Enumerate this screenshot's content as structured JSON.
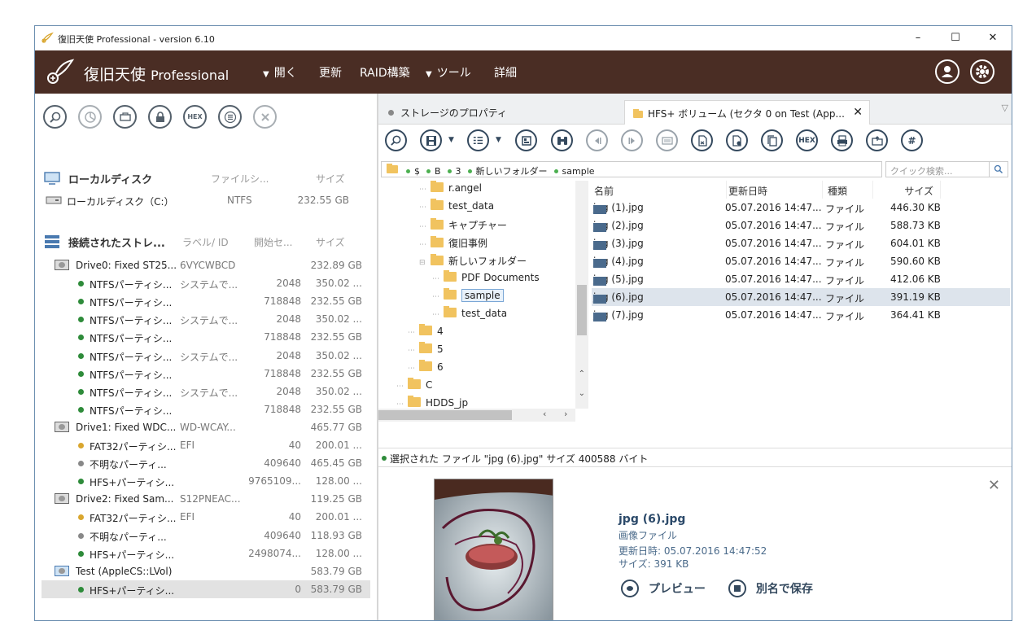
{
  "window": {
    "title": "復旧天使 Professional - version 6.10",
    "minimize": "–",
    "maximize": "☐",
    "close": "✕"
  },
  "menubar": {
    "brand": "復旧天使",
    "brand_pro": "Professional",
    "items": [
      "開く",
      "更新",
      "RAID構築",
      "ツール",
      "詳細"
    ],
    "bg_color": "#4a2d24"
  },
  "left": {
    "local_section": {
      "label": "ローカルディスク",
      "col_fs": "ファイルシ...",
      "col_size": "サイズ"
    },
    "local_drive": {
      "name": "ローカルディスク（C:）",
      "fs": "NTFS",
      "size": "232.55 GB"
    },
    "storage_section": {
      "label": "接続されたストレ...",
      "col_label": "ラベル/ ID",
      "col_start": "開始セ...",
      "col_size": "サイズ"
    },
    "rows": [
      {
        "type": "disk",
        "name": "Drive0: Fixed ST25...",
        "label": "6VYCWBCD",
        "start": "",
        "size": "232.89 GB"
      },
      {
        "type": "part",
        "color": "#2e8b3a",
        "name": "NTFSパーティシ...",
        "label": "システムで...",
        "start": "2048",
        "size": "350.02 ..."
      },
      {
        "type": "part",
        "color": "#2e8b3a",
        "name": "NTFSパーティシ...",
        "label": "",
        "start": "718848",
        "size": "232.55 GB"
      },
      {
        "type": "part",
        "color": "#2e8b3a",
        "name": "NTFSパーティシ...",
        "label": "システムで...",
        "start": "2048",
        "size": "350.02 ..."
      },
      {
        "type": "part",
        "color": "#2e8b3a",
        "name": "NTFSパーティシ...",
        "label": "",
        "start": "718848",
        "size": "232.55 GB"
      },
      {
        "type": "part",
        "color": "#2e8b3a",
        "name": "NTFSパーティシ...",
        "label": "システムで...",
        "start": "2048",
        "size": "350.02 ..."
      },
      {
        "type": "part",
        "color": "#2e8b3a",
        "name": "NTFSパーティシ...",
        "label": "",
        "start": "718848",
        "size": "232.55 GB"
      },
      {
        "type": "part",
        "color": "#2e8b3a",
        "name": "NTFSパーティシ...",
        "label": "システムで...",
        "start": "2048",
        "size": "350.02 ..."
      },
      {
        "type": "part",
        "color": "#2e8b3a",
        "name": "NTFSパーティシ...",
        "label": "",
        "start": "718848",
        "size": "232.55 GB"
      },
      {
        "type": "disk",
        "name": "Drive1: Fixed WDC...",
        "label": "WD-WCAY...",
        "start": "",
        "size": "465.77 GB"
      },
      {
        "type": "part",
        "color": "#d9a62e",
        "name": "FAT32パーティシ...",
        "label": "EFI",
        "start": "40",
        "size": "200.01 ..."
      },
      {
        "type": "part",
        "color": "#888888",
        "name": "不明なパーティ...",
        "label": "",
        "start": "409640",
        "size": "465.45 GB"
      },
      {
        "type": "part",
        "color": "#2e8b3a",
        "name": "HFS+パーティシ...",
        "label": "",
        "start": "9765109...",
        "size": "128.00 ..."
      },
      {
        "type": "disk",
        "name": "Drive2: Fixed Sam...",
        "label": "S12PNEAC...",
        "start": "",
        "size": "119.25 GB"
      },
      {
        "type": "part",
        "color": "#d9a62e",
        "name": "FAT32パーティシ...",
        "label": "EFI",
        "start": "40",
        "size": "200.01 ..."
      },
      {
        "type": "part",
        "color": "#888888",
        "name": "不明なパーティ...",
        "label": "",
        "start": "409640",
        "size": "118.93 GB"
      },
      {
        "type": "part",
        "color": "#2e8b3a",
        "name": "HFS+パーティシ...",
        "label": "",
        "start": "2498074...",
        "size": "128.00 ..."
      },
      {
        "type": "vdisk",
        "name": "Test (AppleCS::LVol)",
        "label": "",
        "start": "",
        "size": "583.79 GB"
      },
      {
        "type": "part",
        "color": "#2e8b3a",
        "name": "HFS+パーティシ...",
        "label": "",
        "start": "0",
        "size": "583.79 GB",
        "selected": true
      }
    ]
  },
  "tabs": {
    "storage_props": "ストレージのプロパティ",
    "volume": "HFS+ ボリューム (セクタ 0 on Test (App..."
  },
  "toolbar2": {
    "hex": "HEX"
  },
  "breadcrumb": [
    "$",
    "B",
    "3",
    "新しいフォルダー",
    "sample"
  ],
  "search": {
    "placeholder": "クイック検索..."
  },
  "tree": [
    {
      "label": "r.angel",
      "indent": 2
    },
    {
      "label": "test_data",
      "indent": 2
    },
    {
      "label": "キャプチャー",
      "indent": 2
    },
    {
      "label": "復旧事例",
      "indent": 2
    },
    {
      "label": "新しいフォルダー",
      "indent": 2,
      "expanded": true
    },
    {
      "label": "PDF Documents",
      "indent": 3
    },
    {
      "label": "sample",
      "indent": 3,
      "selected": true
    },
    {
      "label": "test_data",
      "indent": 3
    },
    {
      "label": "4",
      "indent": 1
    },
    {
      "label": "5",
      "indent": 1
    },
    {
      "label": "6",
      "indent": 1
    },
    {
      "label": "C",
      "indent": 0
    },
    {
      "label": "HDDS_jp",
      "indent": 0
    }
  ],
  "files": {
    "headers": {
      "name": "名前",
      "date": "更新日時",
      "kind": "種類",
      "size": "サイズ"
    },
    "rows": [
      {
        "name": "jpg (1).jpg",
        "date": "05.07.2016 14:47...",
        "kind": "ファイル",
        "size": "446.30 KB"
      },
      {
        "name": "jpg (2).jpg",
        "date": "05.07.2016 14:47...",
        "kind": "ファイル",
        "size": "588.73 KB"
      },
      {
        "name": "jpg (3).jpg",
        "date": "05.07.2016 14:47...",
        "kind": "ファイル",
        "size": "604.01 KB"
      },
      {
        "name": "jpg (4).jpg",
        "date": "05.07.2016 14:47...",
        "kind": "ファイル",
        "size": "590.60 KB"
      },
      {
        "name": "jpg (5).jpg",
        "date": "05.07.2016 14:47...",
        "kind": "ファイル",
        "size": "412.06 KB"
      },
      {
        "name": "jpg (6).jpg",
        "date": "05.07.2016 14:47...",
        "kind": "ファイル",
        "size": "391.19 KB",
        "selected": true
      },
      {
        "name": "jpg (7).jpg",
        "date": "05.07.2016 14:47...",
        "kind": "ファイル",
        "size": "364.41 KB"
      }
    ]
  },
  "status": {
    "text": "選択された ファイル \"jpg (6).jpg\" サイズ 400588 バイト"
  },
  "preview": {
    "filename": "jpg (6).jpg",
    "filetype": "画像ファイル",
    "modified": "更新日時: 05.07.2016 14:47:52",
    "size": "サイズ: 391 KB",
    "preview_btn": "プレビュー",
    "save_btn": "別名で保存"
  }
}
